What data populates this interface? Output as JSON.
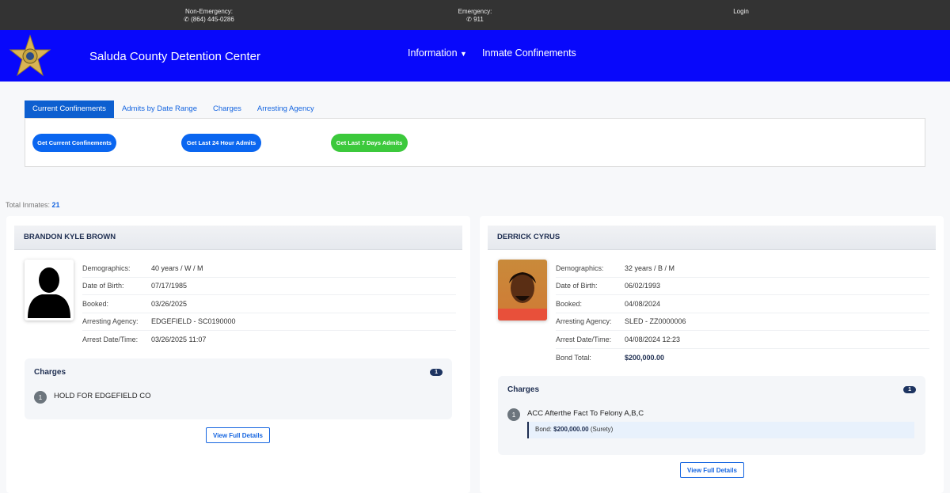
{
  "topbar": {
    "non_emergency_label": "Non-Emergency:",
    "non_emergency_phone": "(864) 445-0286",
    "emergency_label": "Emergency:",
    "emergency_phone": "911",
    "login": "Login"
  },
  "header": {
    "title": "Saluda County Detention Center",
    "nav": [
      {
        "label": "Information"
      },
      {
        "label": "Inmate Confinements"
      }
    ]
  },
  "tabs": [
    {
      "label": "Current Confinements",
      "active": true
    },
    {
      "label": "Admits by Date Range"
    },
    {
      "label": "Charges"
    },
    {
      "label": "Arresting Agency"
    }
  ],
  "buttons": {
    "current": "Get Current Confinements",
    "last24": "Get Last 24 Hour Admits",
    "last7": "Get Last 7 Days Admits"
  },
  "colors": {
    "header": "#0808fb",
    "primary": "#1565e0",
    "green": "#3cc93c",
    "navy": "#1d2d50"
  },
  "total": {
    "label": "Total Inmates:",
    "value": "21"
  },
  "inmates": [
    {
      "name": "BRANDON KYLE BROWN",
      "fields": [
        {
          "label": "Demographics:",
          "value": "40 years / W / M"
        },
        {
          "label": "Date of Birth:",
          "value": "07/17/1985"
        },
        {
          "label": "Booked:",
          "value": "03/26/2025"
        },
        {
          "label": "Arresting Agency:",
          "value": "EDGEFIELD - SC0190000"
        },
        {
          "label": "Arrest Date/Time:",
          "value": "03/26/2025 11:07"
        }
      ],
      "charges_title": "Charges",
      "charge_count": "1",
      "charges": [
        {
          "num": "1",
          "text": "HOLD FOR EDGEFIELD CO"
        }
      ],
      "details": "View Full Details"
    },
    {
      "name": "DERRICK CYRUS",
      "fields": [
        {
          "label": "Demographics:",
          "value": "32 years / B / M"
        },
        {
          "label": "Date of Birth:",
          "value": "06/02/1993"
        },
        {
          "label": "Booked:",
          "value": "04/08/2024"
        },
        {
          "label": "Arresting Agency:",
          "value": "SLED - ZZ0000006"
        },
        {
          "label": "Arrest Date/Time:",
          "value": "04/08/2024 12:23"
        },
        {
          "label": "Bond Total:",
          "value": "$200,000.00"
        }
      ],
      "charges_title": "Charges",
      "charge_count": "1",
      "charges": [
        {
          "num": "1",
          "text": "ACC Afterthe Fact To Felony A,B,C",
          "bond_label": "Bond:",
          "bond_amount": "$200,000.00",
          "bond_type": "(Surety)"
        }
      ],
      "details": "View Full Details"
    }
  ]
}
